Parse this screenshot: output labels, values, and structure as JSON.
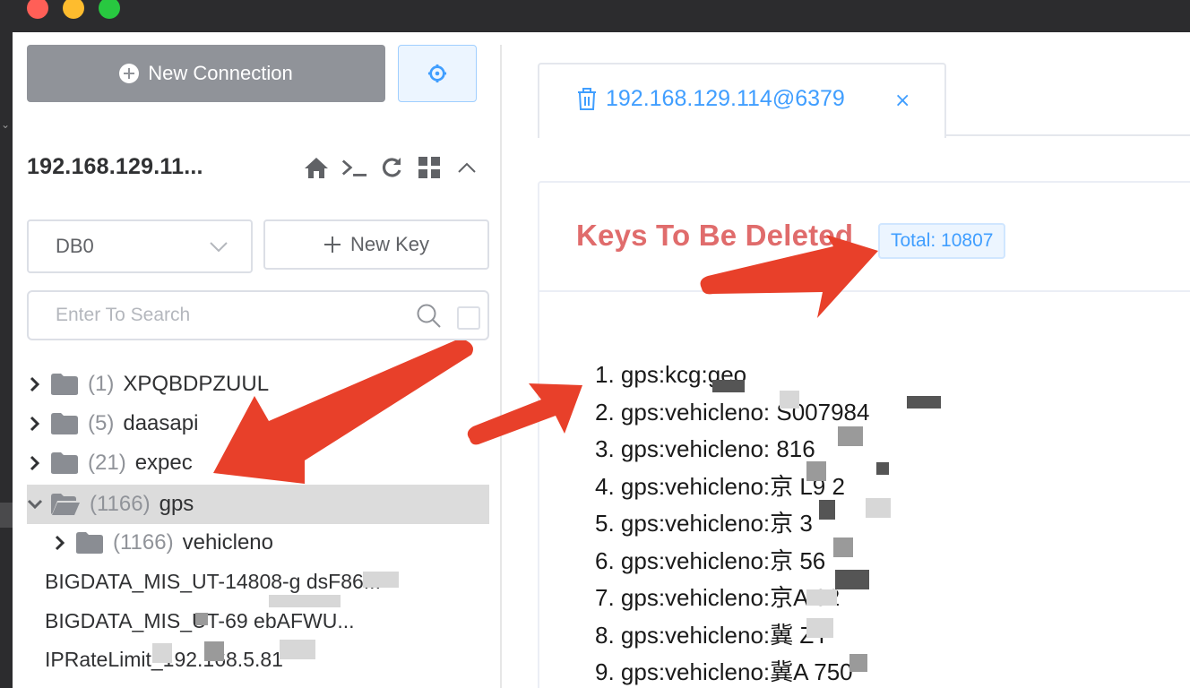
{
  "sidebar": {
    "new_connection_label": "New Connection",
    "connection_name": "192.168.129.11...",
    "db_select_value": "DB0",
    "new_key_label": "New Key",
    "search_placeholder": "Enter To Search",
    "tree": [
      {
        "count": "(1)",
        "name": "XPQBDPZUUL",
        "expanded": false
      },
      {
        "count": "(5)",
        "name": "daasapi",
        "expanded": false
      },
      {
        "count": "(21)",
        "name": "expec",
        "expanded": false
      },
      {
        "count": "(1166)",
        "name": "gps",
        "expanded": true
      },
      {
        "count": "(1166)",
        "name": "vehicleno",
        "expanded": false
      }
    ],
    "keys": [
      "BIGDATA_MIS_UT-14808-g  dsF86...",
      "BIGDATA_MIS_UT-69   ebAFWU...",
      "IPRateLimit_192.168.5.81"
    ]
  },
  "tab": {
    "label": "192.168.129.114@6379"
  },
  "panel": {
    "title": "Keys To Be Deleted",
    "total": "Total: 10807",
    "items": [
      "1. gps:kcg:geo",
      "2. gps:vehicleno:   S007984",
      "3. gps:vehicleno:   816",
      "4. gps:vehicleno:京  L9 2",
      "5. gps:vehicleno:京   3",
      "6. gps:vehicleno:京  56",
      "7. gps:vehicleno:京A  62",
      "8. gps:vehicleno:冀  ZY",
      "9. gps:vehicleno:冀A  750"
    ]
  },
  "colors": {
    "accent": "#409eff",
    "danger_title": "#e06c6c",
    "annotation_arrow": "#e8402a",
    "button_gray": "#909399"
  },
  "icons": [
    "plus-circle-icon",
    "settings-icon",
    "home-icon",
    "terminal-icon",
    "refresh-icon",
    "grid-icon",
    "chevron-up-icon",
    "chevron-down-icon",
    "plus-icon",
    "search-icon",
    "folder-icon",
    "folder-open-icon",
    "trash-icon",
    "close-icon"
  ]
}
